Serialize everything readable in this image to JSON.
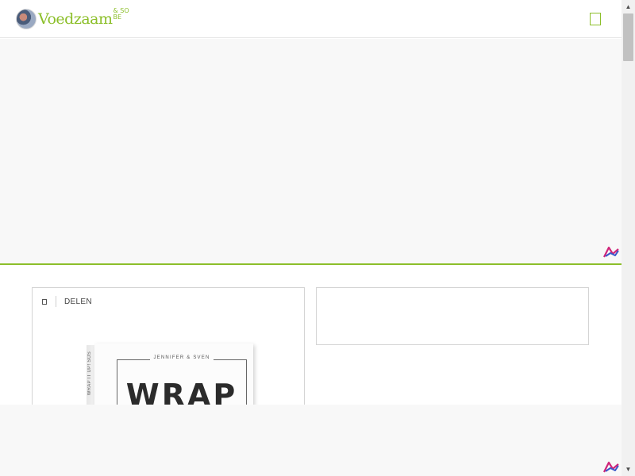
{
  "header": {
    "logo": {
      "brand": "Voedzaam",
      "suffix": "& SO",
      "sub": "BE"
    },
    "menu_icon": "menu-icon"
  },
  "article": {
    "share_icon": "share-icon",
    "share_label": "DELEN",
    "book": {
      "spine_text": "WRAP IT UP! SOS",
      "author": "JENNIFER & SVEN",
      "title": "WRAP"
    }
  },
  "ads": {
    "logo_icon": "ad-logo-icon"
  },
  "scrollbar": {
    "up_icon": "scroll-up-icon",
    "down_icon": "scroll-down-icon"
  },
  "colors": {
    "accent": "#8cbf2a",
    "ad_background": "#f8f8f8",
    "border": "#d4d4d4"
  }
}
